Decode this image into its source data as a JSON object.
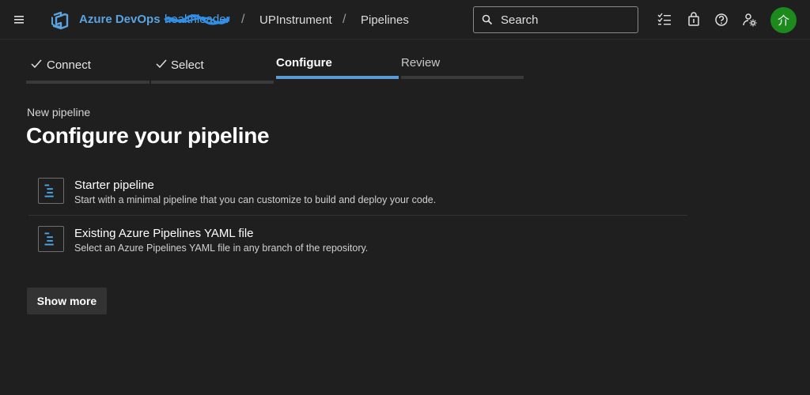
{
  "header": {
    "brand": "Azure DevOps",
    "org": "healthleader",
    "breadcrumbs": [
      "UPInstrument",
      "Pipelines"
    ],
    "search_placeholder": "Search",
    "avatar_initials": "介",
    "icons": [
      "menu-icon",
      "azure-devops-logo-icon",
      "search-icon",
      "task-list-icon",
      "shopping-bag-icon",
      "help-icon",
      "user-settings-icon"
    ],
    "avatar_color": "#1c8a1c",
    "brand_color": "#5ba3e0"
  },
  "steps": [
    {
      "label": "Connect",
      "state": "done"
    },
    {
      "label": "Select",
      "state": "done"
    },
    {
      "label": "Configure",
      "state": "active"
    },
    {
      "label": "Review",
      "state": "pending"
    }
  ],
  "accent_color": "#5b9bd5",
  "main": {
    "subtitle": "New pipeline",
    "title": "Configure your pipeline",
    "options": [
      {
        "title": "Starter pipeline",
        "description": "Start with a minimal pipeline that you can customize to build and deploy your code."
      },
      {
        "title": "Existing Azure Pipelines YAML file",
        "description": "Select an Azure Pipelines YAML file in any branch of the repository."
      }
    ],
    "show_more_label": "Show more"
  }
}
